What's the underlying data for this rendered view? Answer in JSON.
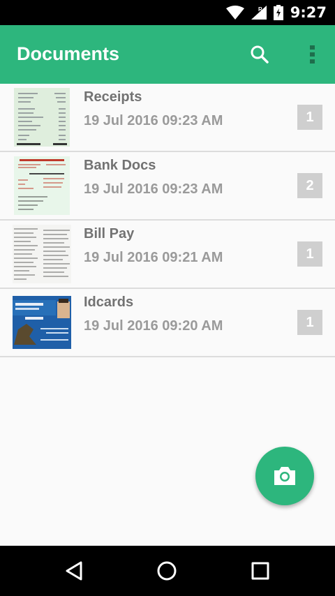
{
  "status_bar": {
    "time": "9:27",
    "icons": [
      "wifi-icon",
      "cell-signal-icon",
      "roaming-icon",
      "battery-charging-icon"
    ]
  },
  "app_bar": {
    "title": "Documents",
    "search_icon": "search-icon",
    "menu_icon": "overflow-menu-icon",
    "color": "#2db67d"
  },
  "documents": [
    {
      "title": "Receipts",
      "date": "19 Jul 2016 09:23 AM",
      "pages": "1",
      "thumbnail": "receipt-thumbnail"
    },
    {
      "title": "Bank Docs",
      "date": "19 Jul 2016 09:23 AM",
      "pages": "2",
      "thumbnail": "bank-doc-thumbnail"
    },
    {
      "title": "Bill Pay",
      "date": "19 Jul 2016 09:21 AM",
      "pages": "1",
      "thumbnail": "bill-thumbnail"
    },
    {
      "title": "Idcards",
      "date": "19 Jul 2016 09:20 AM",
      "pages": "1",
      "thumbnail": "id-card-thumbnail"
    }
  ],
  "fab": {
    "icon": "camera-icon"
  },
  "nav_bar": {
    "icons": [
      "back-icon",
      "home-icon",
      "recents-icon"
    ]
  }
}
